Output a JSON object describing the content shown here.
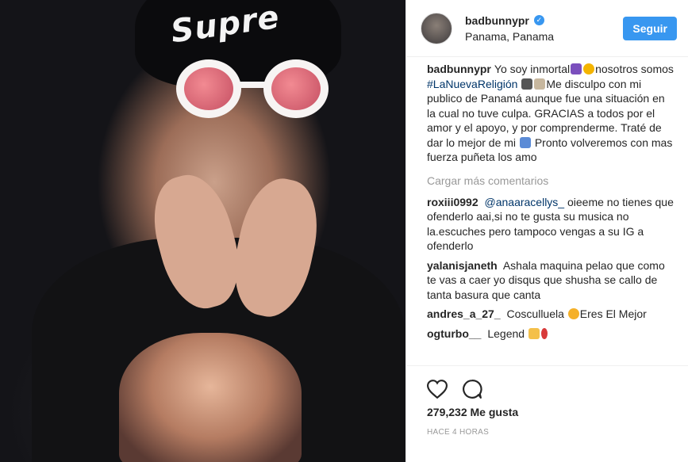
{
  "post": {
    "username": "badbunnypr",
    "verified": true,
    "location": "Panama, Panama",
    "follow_label": "Seguir",
    "photo_text": "Supre",
    "caption": {
      "author": "badbunnypr",
      "part1": "Yo soy inmortal",
      "part2": "nosotros somos",
      "hashtag": "#LaNuevaReligión",
      "part3": "Me disculpo con mi publico de Panamá aunque fue una situación en la cual no tuve culpa. GRACIAS a todos por el amor y el apoyo, y por comprenderme. Traté de dar lo mejor de mi",
      "part4": "Pronto volveremos con mas fuerza puñeta los amo"
    },
    "load_more_label": "Cargar más comentarios",
    "comments": [
      {
        "author": "roxiii0992",
        "mention": "@anaaracellys_",
        "text": "oieeme no tienes que ofenderlo aai,si no te gusta su musica no la.escuches pero tampoco vengas a su IG a ofenderlo"
      },
      {
        "author": "yalanisjaneth",
        "text": "Ashala maquina pelao que como te vas a caer yo disqus que shusha se callo de tanta basura que canta"
      },
      {
        "author": "andres_a_27_",
        "text": "Cosculluela",
        "text_after": "Eres El Mejor"
      },
      {
        "author": "ogturbo__",
        "text": "Legend"
      }
    ],
    "likes": "279,232 Me gusta",
    "timestamp": "HACE 4 HORAS",
    "colors": {
      "accent": "#3897f0",
      "hashtag": "#003569",
      "muted": "#999999"
    },
    "icons": [
      "verified-icon",
      "heart-icon",
      "comment-icon"
    ]
  }
}
